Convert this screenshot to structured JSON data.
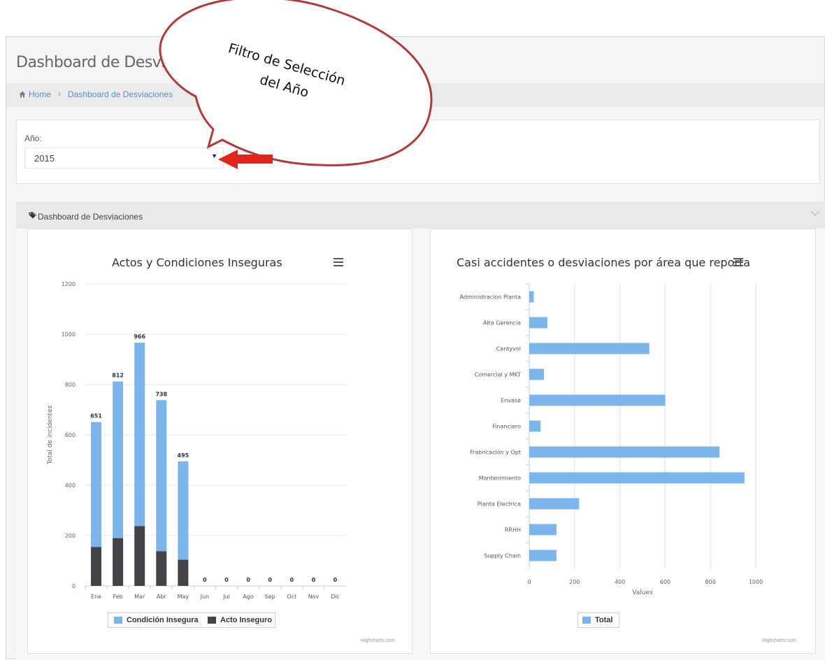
{
  "header": {
    "title": "Dashboard de Desviaciones"
  },
  "breadcrumb": {
    "home": "Home",
    "separator": "›",
    "current": "Dashboard de Desviaciones"
  },
  "filter": {
    "label": "Año:",
    "selected": "2015"
  },
  "panel": {
    "title": "Dashboard de Desviaciones"
  },
  "callout": {
    "line1": "Filtro de Selección",
    "line2": "del Año"
  },
  "colors": {
    "condicion": "#7cb5ec",
    "acto": "#434348",
    "arrow": "#e1251b",
    "callout_border": "#b03a3a"
  },
  "icons": {
    "home": "home-icon",
    "tag": "tag-icon",
    "collapse": "chevron-down-icon",
    "menu": "menu-icon",
    "dropdown": "dropdown-arrow-icon"
  },
  "chart_data": [
    {
      "type": "bar",
      "stacked": true,
      "title": "Actos y Condiciones Inseguras",
      "ylabel": "Total de incidentes",
      "xlabel": "",
      "ylim": [
        0,
        1200
      ],
      "yticks": [
        0,
        200,
        400,
        600,
        800,
        1000,
        1200
      ],
      "categories": [
        "Ene",
        "Feb",
        "Mar",
        "Abr",
        "May",
        "Jun",
        "Jul",
        "Ago",
        "Sep",
        "Oct",
        "Nov",
        "Dic"
      ],
      "series": [
        {
          "name": "Condición Insegura",
          "values": [
            496,
            622,
            728,
            600,
            391,
            0,
            0,
            0,
            0,
            0,
            0,
            0
          ]
        },
        {
          "name": "Acto Inseguro",
          "values": [
            155,
            190,
            238,
            138,
            104,
            0,
            0,
            0,
            0,
            0,
            0,
            0
          ]
        }
      ],
      "totals": [
        651,
        812,
        966,
        738,
        495,
        0,
        0,
        0,
        0,
        0,
        0,
        0
      ],
      "legend": "bottom",
      "credit": "Highcharts.com"
    },
    {
      "type": "bar",
      "orientation": "horizontal",
      "title": "Casi accidentes o desviaciones por área que reporta",
      "xlabel": "Values",
      "xlim": [
        0,
        1000
      ],
      "xticks": [
        0,
        200,
        400,
        600,
        800,
        1000
      ],
      "categories": [
        "Administracion Planta",
        "Alta Gerencia",
        "Cantyvol",
        "Comercial y MKT",
        "Envase",
        "Financiero",
        "Frabricación y Opt",
        "Mantenimiento",
        "Planta Electrica",
        "RRHH",
        "Supply Chain"
      ],
      "series": [
        {
          "name": "Total",
          "values": [
            20,
            80,
            530,
            65,
            600,
            50,
            840,
            950,
            220,
            120,
            120
          ]
        }
      ],
      "legend": "bottom",
      "credit": "Highcharts.com"
    }
  ]
}
